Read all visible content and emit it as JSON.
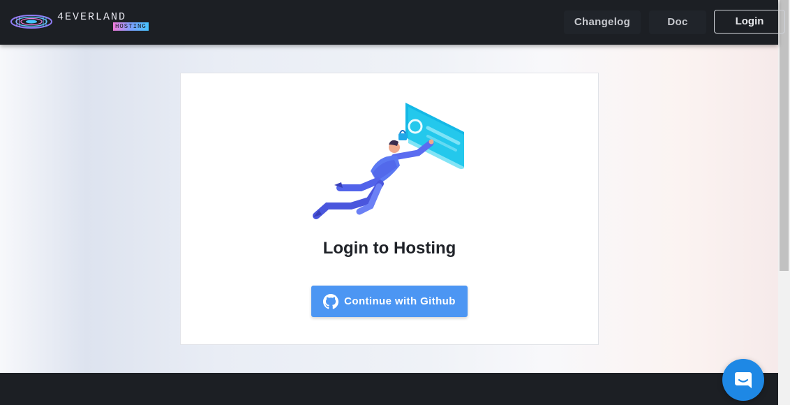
{
  "header": {
    "logo": {
      "wordmark": "4EVERLAND",
      "badge": "HOSTING"
    },
    "nav": [
      {
        "label": "Changelog"
      },
      {
        "label": "Doc"
      }
    ],
    "login_label": "Login"
  },
  "card": {
    "illustration_icon": "person-unlocking-card-illustration",
    "title": "Login to Hosting",
    "github_button": {
      "icon": "github-icon",
      "label": "Continue with Github"
    }
  },
  "chat_launcher": {
    "icon": "chat-bubble-icon"
  },
  "colors": {
    "header_bg": "#1c1f24",
    "button_primary": "#4c96f3",
    "chat_launcher": "#1e88e5",
    "card_bg": "#ffffff"
  }
}
